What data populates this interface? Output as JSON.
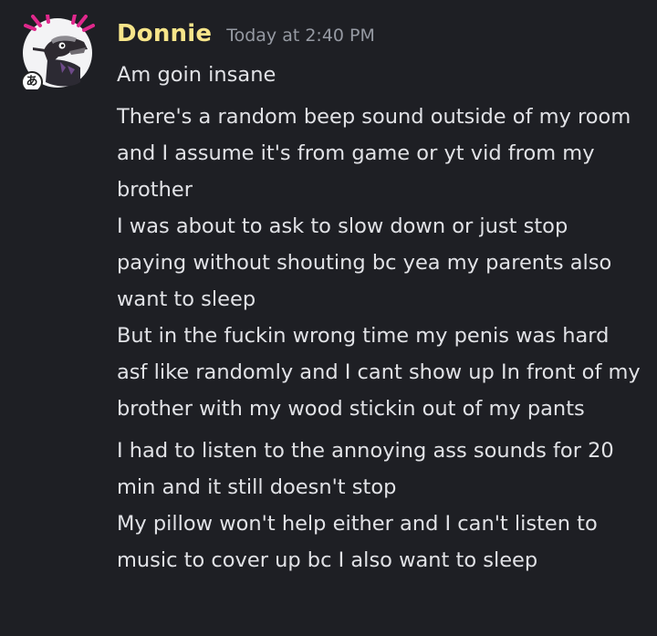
{
  "author": {
    "name": "Donnie",
    "timestamp": "Today at 2:40 PM",
    "avatar_badge": "あ"
  },
  "messages": [
    "Am goin insane",
    "There's a random beep sound outside of my room and I assume it's from game or yt vid from my brother",
    "I was about to ask to slow down or just stop paying without shouting bc yea my parents also want to sleep",
    "But in the fuckin wrong time my penis was hard asf like randomly and I cant show up In front of my brother with my wood stickin out of my pants",
    "I had to listen to the annoying ass sounds for 20 min and it still doesn't stop",
    "My pillow won't help either and I can't listen to music to cover up bc I also want to sleep"
  ],
  "colors": {
    "background": "#1e1f24",
    "username": "#f7e58a",
    "timestamp": "#969aa3",
    "message_text": "#e1e2e6",
    "avatar_accent": "#e0288c"
  }
}
